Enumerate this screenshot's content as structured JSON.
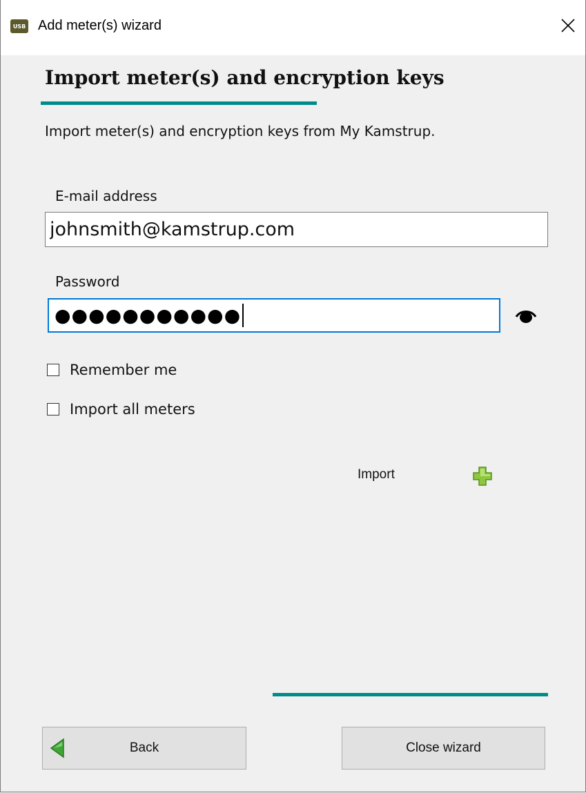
{
  "window": {
    "title": "Add meter(s) wizard",
    "app_icon_text": "USB",
    "close_icon": "close-icon"
  },
  "page": {
    "heading": "Import meter(s) and encryption keys",
    "subtitle": "Import meter(s) and encryption keys from My Kamstrup."
  },
  "form": {
    "email_label": "E-mail address",
    "email_value": "johnsmith@kamstrup.com",
    "password_label": "Password",
    "password_masked": "●●●●●●●●●●●",
    "show_password_icon": "eye-icon",
    "remember_me_label": "Remember me",
    "remember_me_checked": false,
    "import_all_label": "Import all meters",
    "import_all_checked": false
  },
  "import_action": {
    "label": "Import",
    "icon": "plus-icon"
  },
  "footer": {
    "back_label": "Back",
    "back_icon": "back-arrow-icon",
    "close_label": "Close wizard"
  },
  "colors": {
    "accent": "#008b8b",
    "focus_border": "#0078d7",
    "plus_green": "#8dc63f",
    "back_arrow_green": "#3fa535"
  }
}
